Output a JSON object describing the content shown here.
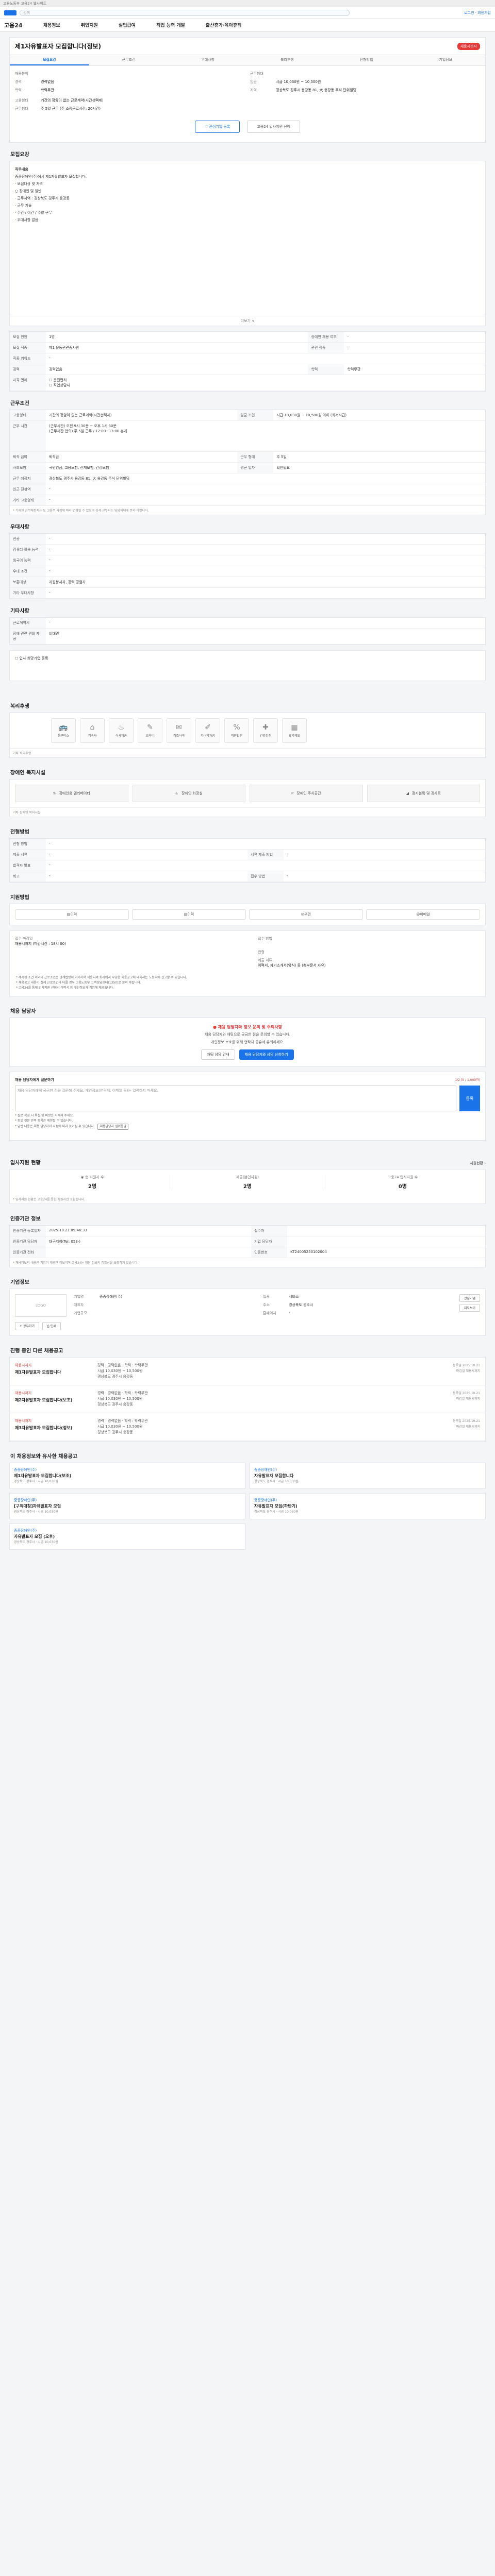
{
  "topbar": {
    "text": "고용노동부 고용24 웹사이트"
  },
  "header": {
    "search_placeholder": "검색",
    "right_link": "로그인 · 회원가입"
  },
  "gnb": {
    "home": "고용24",
    "items": [
      "채용정보",
      "취업지원",
      "실업급여",
      "직업 능력 개발",
      "출산휴가·육아휴직"
    ]
  },
  "job": {
    "title": "제1자유발표자 모집합니다(정보)",
    "status": "채용시까지",
    "tabs": [
      "모집요강",
      "근무조건",
      "우대사항",
      "복리후생",
      "전형방법",
      "기업정보"
    ],
    "left": [
      {
        "k": "채용분야",
        "v": ""
      },
      {
        "k": "경력",
        "v": "경력없음"
      },
      {
        "k": "학력",
        "v": "학력무관"
      }
    ],
    "right": [
      {
        "k": "근무형태",
        "v": ""
      },
      {
        "k": "임금",
        "v": "시급 10,030원 ~ 10,500원"
      },
      {
        "k": "지역",
        "v": "경상북도 경주시 용강동 81, 大 용강동 주식 단위빌딩"
      }
    ],
    "extra": [
      {
        "k": "고용형태",
        "v": "기간의 정함이 없는 근로계약(시간선택제)"
      },
      {
        "k": "근무형태",
        "v": "주 5일 근무 (주 소정근로시간: 20시간)"
      }
    ],
    "btn_interest": "관심기업 등록",
    "btn_apply": "고용24 입사지원 신청"
  },
  "sections": {
    "recruit": "모집요강",
    "conditions": "근무조건",
    "preference": "우대사항",
    "etc": "기타사항",
    "welfare": "복리후생",
    "disability": "장애인 복지시설",
    "selection": "전형방법",
    "applymethod": "지원방법",
    "contact": "채용 담당자",
    "stats": "입사지원 현황",
    "manager": "인증기관 정보",
    "company": "기업정보",
    "others": "진행 중인 다른 채용공고",
    "recommend": "이 채용정보와 유사한 채용공고"
  },
  "recruit_text": {
    "lines": [
      "직무내용",
      "중증장애인(주)에서 제1자유발표자 모집합니다.",
      "",
      "· 모집대상 및 자격",
      "  ○ 장애인 및 일반",
      "",
      "· 근무지역 : 경상북도 경주시 용강동",
      "  · 근무 기술",
      "  · 주간 / 야간 / 주말 근무",
      "  · 우대사항 없음"
    ],
    "expand": "더보기 ∨"
  },
  "recruit_table": [
    {
      "k": "모집 인원",
      "v": "1명",
      "k2": "장애인 채용 여부",
      "v2": "-"
    },
    {
      "k": "모집 직종",
      "v": "제1 운동관련종사원",
      "k2": "관련 직종",
      "v2": "-"
    },
    {
      "k": "직종 키워드",
      "v": "-",
      "k2": "",
      "v2": ""
    },
    {
      "k": "경력",
      "v": "경력없음",
      "k2": "학력",
      "v2": "학력무관"
    },
    {
      "k": "자격 면허",
      "v": "☐ 운전면허\n☐ 직업상담사",
      "k2": "",
      "v2": ""
    }
  ],
  "cond_table": [
    {
      "k": "고용형태",
      "v": "기간의 정함이 없는 근로계약(시간선택제)",
      "k2": "임금 조건",
      "v2": "시급 10,030원 ~ 10,500원 이하 (최저시급)"
    },
    {
      "k": "근무 시간",
      "v": "(근무시간) 오전 9시 30분 ~ 오후 1시 30분\n(근무시간 협의) 주 5일 근무 / 12:00~13:00 휴게",
      "k2": "",
      "v2": ""
    },
    {
      "k": "퇴직 급여",
      "v": "퇴직금",
      "k2": "근무 형태",
      "v2": "주 5일"
    },
    {
      "k": "사회보험",
      "v": "국민연금, 고용보험, 산재보험, 건강보험",
      "k2": "평균 일자",
      "v2": "확인필요"
    },
    {
      "k": "근무 예정지",
      "v": "경상북도 경주시 용강동 81, 大 용강동 주식 단위빌딩",
      "k2": "",
      "v2": ""
    },
    {
      "k": "인근 전철역",
      "v": "-",
      "k2": "",
      "v2": ""
    },
    {
      "k": "기타 고용형태",
      "v": "-",
      "k2": "",
      "v2": ""
    }
  ],
  "cond_note": "* 기재된 근무예정지는 도 고용주 사정에 따라 변경될 수 있으며 상세 근무지는 담당자에게 문의 바랍니다.",
  "pref_table": [
    {
      "k": "전공",
      "v": "-"
    },
    {
      "k": "컴퓨터 활용 능력",
      "v": "-"
    },
    {
      "k": "외국어 능력",
      "v": "-"
    },
    {
      "k": "우대 조건",
      "v": "-"
    },
    {
      "k": "보훈대상",
      "v": "자원봉사자, 경력 경험자"
    },
    {
      "k": "기타 우대사항",
      "v": "-"
    }
  ],
  "etc_table": [
    {
      "k": "근로계약서",
      "v": "-"
    },
    {
      "k": "장애 관련 편의 제공",
      "v": "비대면"
    }
  ],
  "etc_expand": "입사 희망기업 등록",
  "welfare_icons": [
    "통근버스",
    "기숙사",
    "식사제공",
    "교육비",
    "경조사비",
    "자녀학자금",
    "직원할인",
    "건강검진",
    "휴가제도"
  ],
  "welfare_note": "기타 복리후생",
  "disability_icons": [
    "장애인용 엘리베이터",
    "장애인 화장실",
    "장애인 주차공간",
    "점자블록 및 경사로"
  ],
  "disability_note": "기타 장애인 복지시설",
  "select_table": [
    {
      "k": "전형 방법",
      "v": "-"
    },
    {
      "k": "제출 서류",
      "v": "-",
      "k2": "서류 제출 방법",
      "v2": "-"
    },
    {
      "k": "합격자 발표",
      "v": "-",
      "k2": "",
      "v2": ""
    },
    {
      "k": "비고",
      "v": "-",
      "k2": "접수 방법",
      "v2": "-"
    }
  ],
  "method_btns": [
    "이력",
    "이력",
    "우편",
    "이메일"
  ],
  "apply": {
    "rows": [
      {
        "k": "접수 마감일",
        "v": "채용시까지 (마감시간 : 18시 00)",
        "k2": "접수 방법",
        "v2": ""
      },
      {
        "k": "",
        "v": "",
        "k2": "전형",
        "v2": ""
      },
      {
        "k": "",
        "v": "",
        "k2": "제출 서류",
        "v2": "이력서, 자기소개서(양식) 등 (첨부문서 자유)"
      }
    ],
    "bullets": [
      "* 제시된 조건 이외의 근로조건은 관계법령에 의거하여 적용되며 회사에서 부당한 채용공고에 대해서는 노동부에 신고할 수 있습니다.",
      "* 채용공고 내용이 실제 근로조건과 다를 경우 고용노동부 고객상담센터(1350)로 문의 바랍니다.",
      "* 고용24를 통해 입사지원 신청시 이력서 등 개인정보가 기업에 제공됩니다."
    ]
  },
  "chat": {
    "headline": "채용 담당자와 정보 문의 및 주의사항",
    "sub1": "채용 담당자와 채팅으로 궁금한 점을 문의할 수 있습니다.",
    "sub2": "개인정보 보호를 위해 연락처 공유에 유의하세요.",
    "btn1": "채팅 상담 안내",
    "btn2": "채용 담당자와 상담 신청하기"
  },
  "question": {
    "label": "채용 담당자에게 질문하기",
    "right": "1/2 (0 / 1,000자)",
    "placeholder": "채용 담당자에게 궁금한 점을 질문해 주세요. 개인정보(연락처, 이메일 등)는 입력하지 마세요.",
    "submit": "등록",
    "bullets": [
      "* 질문 작성 시 욕설 및 비방은 자제해 주세요.",
      "* 동일 질문 반복 등록은 제한될 수 있습니다.",
      "* 답변 내용은 채용 담당자의 사정에 따라 늦어질 수 있습니다."
    ],
    "bullet_btn": "채용담당자 질의응답"
  },
  "stats": {
    "title_right": "지원현황 ›",
    "items": [
      {
        "lbl": "총 지원자 수",
        "num": "2명"
      },
      {
        "lbl": "제출(본인지원)",
        "num": "2명"
      },
      {
        "lbl": "고용24 입사지원 수",
        "num": "0명"
      }
    ],
    "note": "* 입사지원 현황은 고용24를 통한 지원자만 포함됩니다."
  },
  "manager_table": [
    {
      "k": "인증기관 등록일자",
      "v": "2025.10.21 09:46:33",
      "k2": "접수자",
      "v2": ""
    },
    {
      "k": "인증기관 담당자",
      "v": "대구지청(Tel: 053-)",
      "k2": "기업 담당자",
      "v2": ""
    },
    {
      "k": "인증기관 전화",
      "v": "",
      "k2": "인증번호",
      "v2": "KT24005250102004"
    }
  ],
  "manager_note": "* 채용정보의 내용은 기업이 제공한 정보이며 고용24는 해당 정보의 정확성을 보증하지 않습니다.",
  "company": {
    "logo": "LOGO",
    "info": [
      {
        "k": "기업명",
        "v": "중증장애인(주)"
      },
      {
        "k": "업종",
        "v": "서비스"
      },
      {
        "k": "대표자",
        "v": ""
      },
      {
        "k": "주소",
        "v": "경상북도 경주시"
      },
      {
        "k": "기업규모",
        "v": ""
      },
      {
        "k": "홈페이지",
        "v": "-"
      }
    ],
    "btn_interest": "관심기업",
    "btn_map": "지도보기",
    "share": "공유하기",
    "print": "인쇄"
  },
  "others": [
    {
      "co": "채용시까지",
      "title": "제1자유발표자 모집합니다",
      "desc": "경력 : 경력없음 · 학력 : 학력무관\n시급 10,030원 ~ 10,500원\n경상북도 경주시 용강동",
      "right": "등록일 2025.10.21\n마감일 채용시까지"
    },
    {
      "co": "채용시까지",
      "title": "제2자유발표자 모집합니다(보조)",
      "desc": "경력 : 경력없음 · 학력 : 학력무관\n시급 10,030원 ~ 10,500원\n경상북도 경주시 용강동",
      "right": "등록일 2025.10.21\n마감일 채용시까지"
    },
    {
      "co": "채용시까지",
      "title": "제3자유발표자 모집합니다(정보)",
      "desc": "경력 : 경력없음 · 학력 : 학력무관\n시급 10,030원 ~ 10,500원\n경상북도 경주시 용강동",
      "right": "등록일 2025.10.21\n마감일 채용시까지"
    }
  ],
  "recommend": [
    {
      "co": "중증장애인(주)",
      "title": "제1자유발표자 모집합니다(보조)",
      "meta": "경상북도 경주시 · 시급 10,030원"
    },
    {
      "co": "중증장애인(주)",
      "title": "자유발표자 모집합니다",
      "meta": "경상북도 경주시 · 시급 10,030원"
    },
    {
      "co": "중증장애인(주)",
      "title": "[구직매칭]자유발표자 모집",
      "meta": "경상북도 경주시 · 시급 10,030원"
    },
    {
      "co": "중증장애인(주)",
      "title": "자유발표자 모집(하반기)",
      "meta": "경상북도 경주시 · 시급 10,030원"
    },
    {
      "co": "중증장애인(주)",
      "title": "자유발표자 모집 (오후)",
      "meta": "경상북도 경주시 · 시급 10,030원"
    }
  ]
}
